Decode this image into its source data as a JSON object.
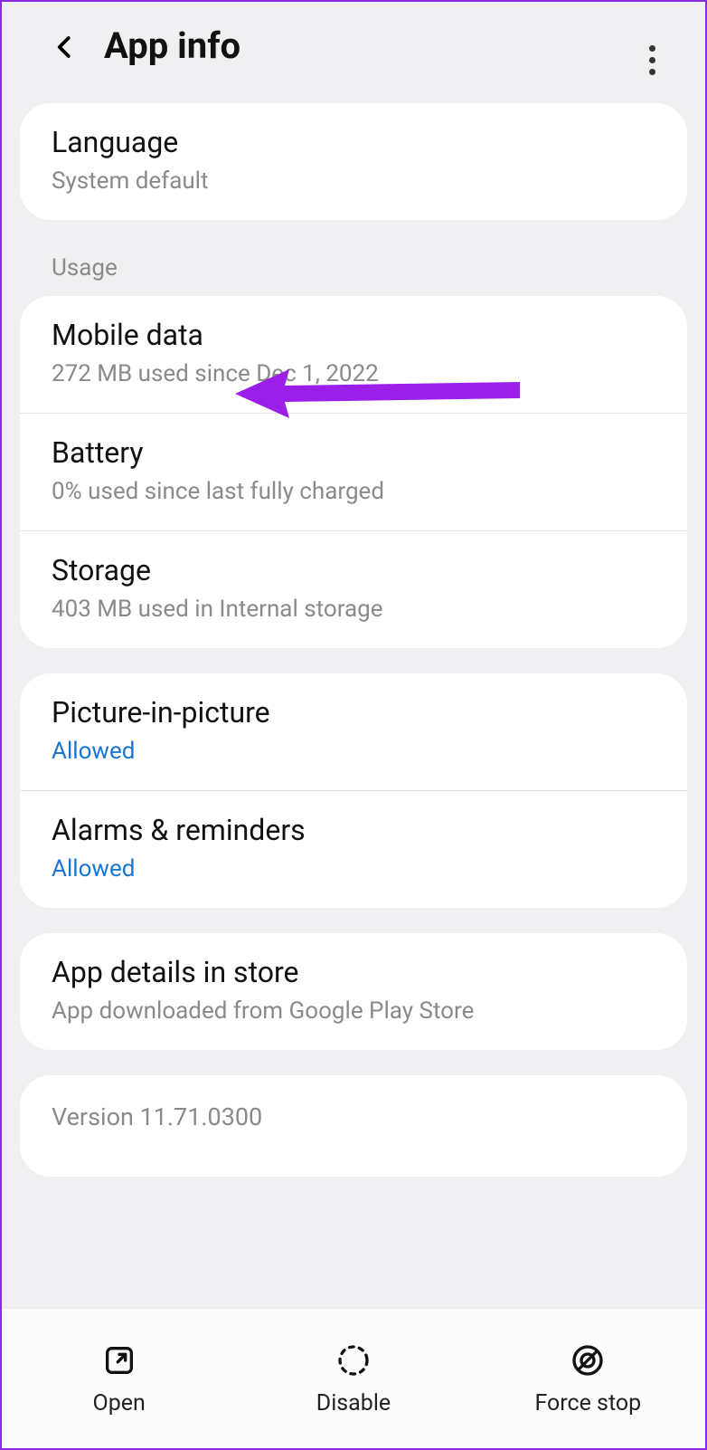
{
  "header": {
    "title": "App info"
  },
  "language": {
    "title": "Language",
    "sub": "System default"
  },
  "usage": {
    "label": "Usage",
    "mobile_data": {
      "title": "Mobile data",
      "sub": "272 MB used since Dec 1, 2022"
    },
    "battery": {
      "title": "Battery",
      "sub": "0% used since last fully charged"
    },
    "storage": {
      "title": "Storage",
      "sub": "403 MB used in Internal storage"
    }
  },
  "perms": {
    "pip": {
      "title": "Picture-in-picture",
      "sub": "Allowed"
    },
    "alarms": {
      "title": "Alarms & reminders",
      "sub": "Allowed"
    }
  },
  "store": {
    "title": "App details in store",
    "sub": "App downloaded from Google Play Store"
  },
  "version": {
    "text": "Version 11.71.0300"
  },
  "bottom": {
    "open": "Open",
    "disable": "Disable",
    "force_stop": "Force stop"
  }
}
